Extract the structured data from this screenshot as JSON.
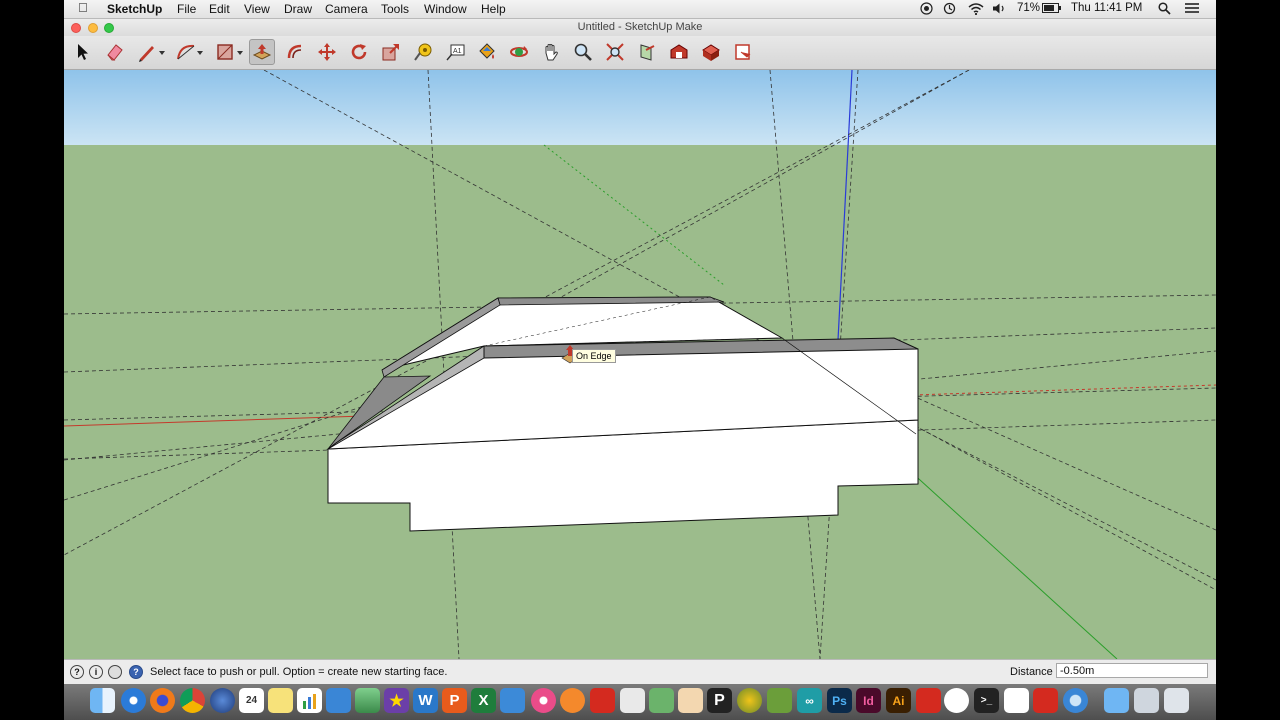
{
  "menubar": {
    "app_name": "SketchUp",
    "items": [
      "File",
      "Edit",
      "View",
      "Draw",
      "Camera",
      "Tools",
      "Window",
      "Help"
    ],
    "battery": "71%",
    "clock": "Thu 11:41 PM"
  },
  "window": {
    "title": "Untitled - SketchUp Make"
  },
  "toolbar": {
    "tools": [
      "select-tool",
      "eraser-tool",
      "line-tool",
      "arc-tool",
      "shape-tool",
      "push-pull-tool",
      "offset-tool",
      "move-tool",
      "rotate-tool",
      "scale-tool",
      "tape-measure-tool",
      "text-tool",
      "paint-bucket-tool",
      "orbit-tool",
      "pan-tool",
      "zoom-tool",
      "zoom-extents-tool",
      "section-plane-tool",
      "3d-warehouse-tool",
      "extension-warehouse-tool",
      "layout-tool"
    ],
    "active": "push-pull-tool"
  },
  "viewport": {
    "tooltip": "On Edge",
    "sky_color": "#a9d3f0",
    "ground_color": "#9cbc8c"
  },
  "statusbar": {
    "message": "Select face to push or pull.  Option = create new starting face.",
    "distance_label": "Distance",
    "distance_value": "-0.50m"
  },
  "dock": {
    "apps": [
      "finder",
      "safari",
      "firefox",
      "chrome",
      "google-earth",
      "calendar",
      "notes",
      "numbers",
      "keynote",
      "photos",
      "imovie",
      "wordpress",
      "pages",
      "excel",
      "control-panel",
      "itunes",
      "ibooks",
      "acrobat",
      "preview",
      "maps",
      "text-edit",
      "pixelmator",
      "arcgis",
      "minecraft",
      "arduino",
      "photoshop",
      "indesign",
      "illustrator",
      "sketchup",
      "cura",
      "terminal",
      "activity-monitor",
      "sketchup-2",
      "quicktime",
      "folder",
      "downloads",
      "trash"
    ]
  }
}
